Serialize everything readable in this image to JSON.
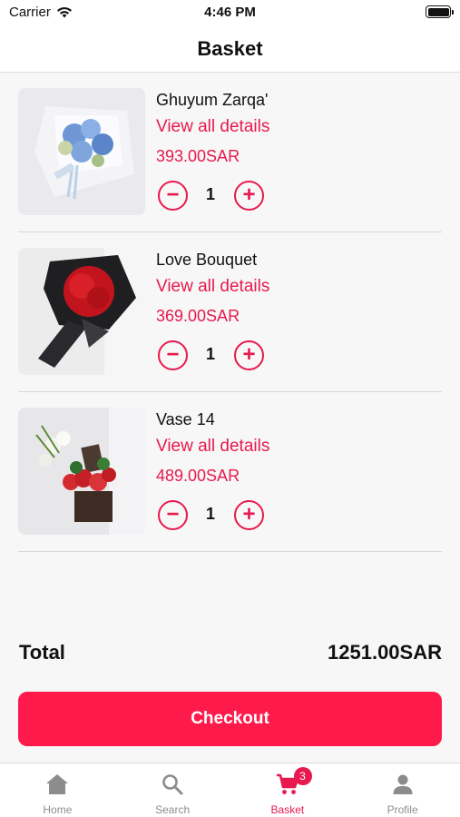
{
  "status_bar": {
    "carrier": "Carrier",
    "time": "4:46 PM"
  },
  "header": {
    "title": "Basket"
  },
  "items": [
    {
      "name": "Ghuyum Zarqa'",
      "details_link": "View all details",
      "price": "393.00SAR",
      "quantity": "1",
      "image": "blue-hydrangea-bouquet"
    },
    {
      "name": "Love Bouquet",
      "details_link": "View all details",
      "price": "369.00SAR",
      "quantity": "1",
      "image": "red-roses-black-wrap-bouquet"
    },
    {
      "name": "Vase 14",
      "details_link": "View all details",
      "price": "489.00SAR",
      "quantity": "1",
      "image": "flower-box-arrangement"
    }
  ],
  "totals": {
    "label": "Total",
    "value": "1251.00SAR"
  },
  "checkout": {
    "label": "Checkout"
  },
  "tab_bar": {
    "tabs": [
      {
        "label": "Home",
        "icon": "home-icon",
        "active": false
      },
      {
        "label": "Search",
        "icon": "search-icon",
        "active": false
      },
      {
        "label": "Basket",
        "icon": "cart-icon",
        "active": true,
        "badge": "3"
      },
      {
        "label": "Profile",
        "icon": "person-icon",
        "active": false
      }
    ]
  },
  "colors": {
    "accent": "#e8194e",
    "checkout_bg": "#fe1a4b",
    "inactive_tab": "#8c8c8c",
    "background": "#f7f7f7"
  }
}
